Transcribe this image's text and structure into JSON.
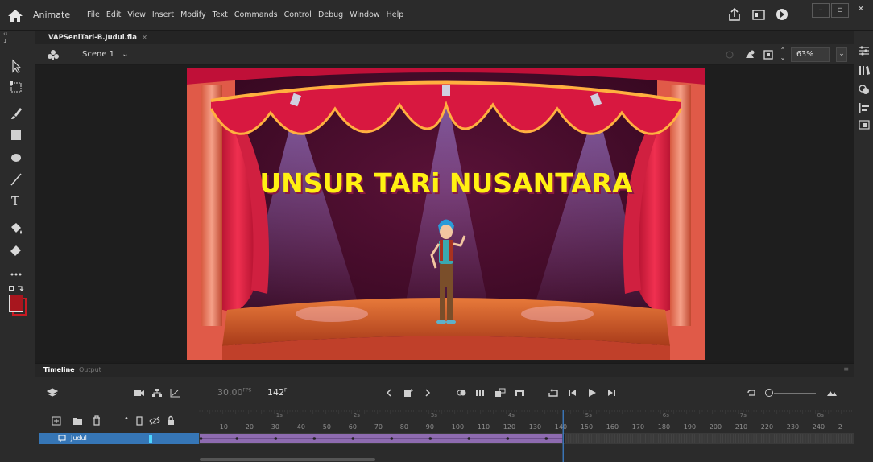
{
  "app": {
    "name": "Animate",
    "menus": [
      "File",
      "Edit",
      "View",
      "Insert",
      "Modify",
      "Text",
      "Commands",
      "Control",
      "Debug",
      "Window",
      "Help"
    ]
  },
  "document": {
    "tab_name": "VAPSeniTari-B.Judul.fla",
    "tab_close": "×",
    "scene": "Scene 1",
    "zoom": "63%"
  },
  "stage": {
    "title_text": "UNSUR TARi NUSANTARA"
  },
  "panel_side": {
    "collapse_mark": "‹‹",
    "row_number": "1"
  },
  "timeline": {
    "tab_timeline": "Timeline",
    "tab_output": "Output",
    "fps_value": "30,00",
    "fps_unit": "FPS",
    "current_frame": "142",
    "frame_unit": "F",
    "seconds_labels": [
      "1s",
      "2s",
      "3s",
      "4s",
      "5s",
      "6s",
      "7s",
      "8s"
    ],
    "frame_numbers": [
      "10",
      "20",
      "30",
      "40",
      "50",
      "60",
      "70",
      "80",
      "90",
      "100",
      "110",
      "120",
      "130",
      "140",
      "150",
      "160",
      "170",
      "180",
      "190",
      "200",
      "210",
      "220",
      "230",
      "240",
      "2"
    ],
    "layer_name": "Judul",
    "tween_end_frame": 142,
    "playhead_frame": 142
  },
  "colors": {
    "stroke_color": "#a8161e",
    "fill_color": "#c81a22",
    "layer_selected": "#3676b6",
    "tween_span": "#8e6bb0",
    "playhead": "#3f86d6"
  }
}
